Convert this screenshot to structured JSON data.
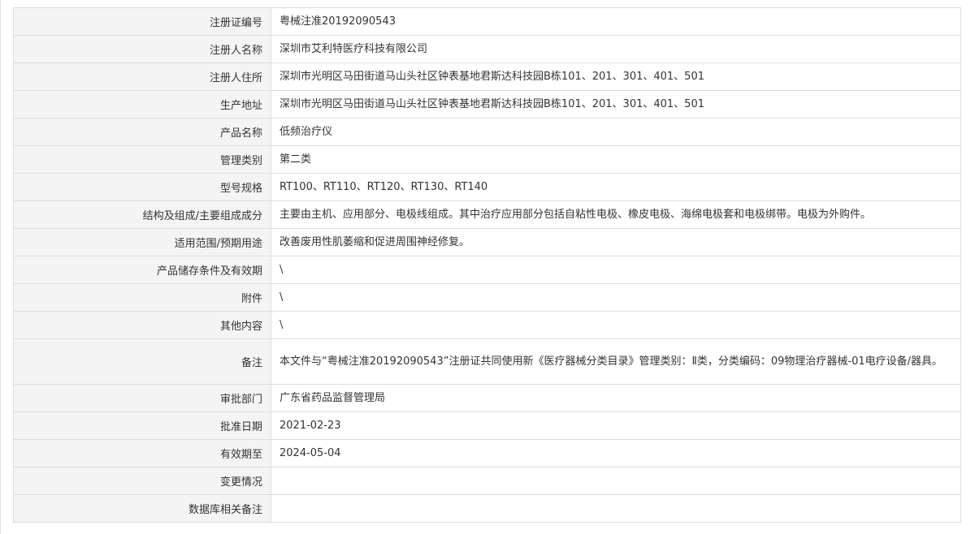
{
  "rows": [
    {
      "label": "注册证编号",
      "value": "粤械注准20192090543"
    },
    {
      "label": "注册人名称",
      "value": "深圳市艾利特医疗科技有限公司"
    },
    {
      "label": "注册人住所",
      "value": "深圳市光明区马田街道马山头社区钟表基地君斯达科技园B栋101、201、301、401、501"
    },
    {
      "label": "生产地址",
      "value": "深圳市光明区马田街道马山头社区钟表基地君斯达科技园B栋101、201、301、401、501"
    },
    {
      "label": "产品名称",
      "value": "低频治疗仪"
    },
    {
      "label": "管理类别",
      "value": "第二类"
    },
    {
      "label": "型号规格",
      "value": "RT100、RT110、RT120、RT130、RT140"
    },
    {
      "label": "结构及组成/主要组成成分",
      "value": "主要由主机、应用部分、电极线组成。其中治疗应用部分包括自粘性电极、橡皮电极、海绵电极套和电极绑带。电极为外购件。"
    },
    {
      "label": "适用范围/预期用途",
      "value": "改善废用性肌萎缩和促进周围神经修复。"
    },
    {
      "label": "产品储存条件及有效期",
      "value": "\\"
    },
    {
      "label": "附件",
      "value": "\\"
    },
    {
      "label": "其他内容",
      "value": "\\"
    },
    {
      "label": "备注",
      "value": "本文件与“粤械注准20192090543”注册证共同使用新《医疗器械分类目录》管理类别：Ⅱ类，分类编码：09物理治疗器械-01电疗设备/器具。"
    },
    {
      "label": "审批部门",
      "value": "广东省药品监督管理局"
    },
    {
      "label": "批准日期",
      "value": "2021-02-23"
    },
    {
      "label": "有效期至",
      "value": "2024-05-04"
    },
    {
      "label": "变更情况",
      "value": ""
    },
    {
      "label": "数据库相关备注",
      "value": ""
    }
  ]
}
